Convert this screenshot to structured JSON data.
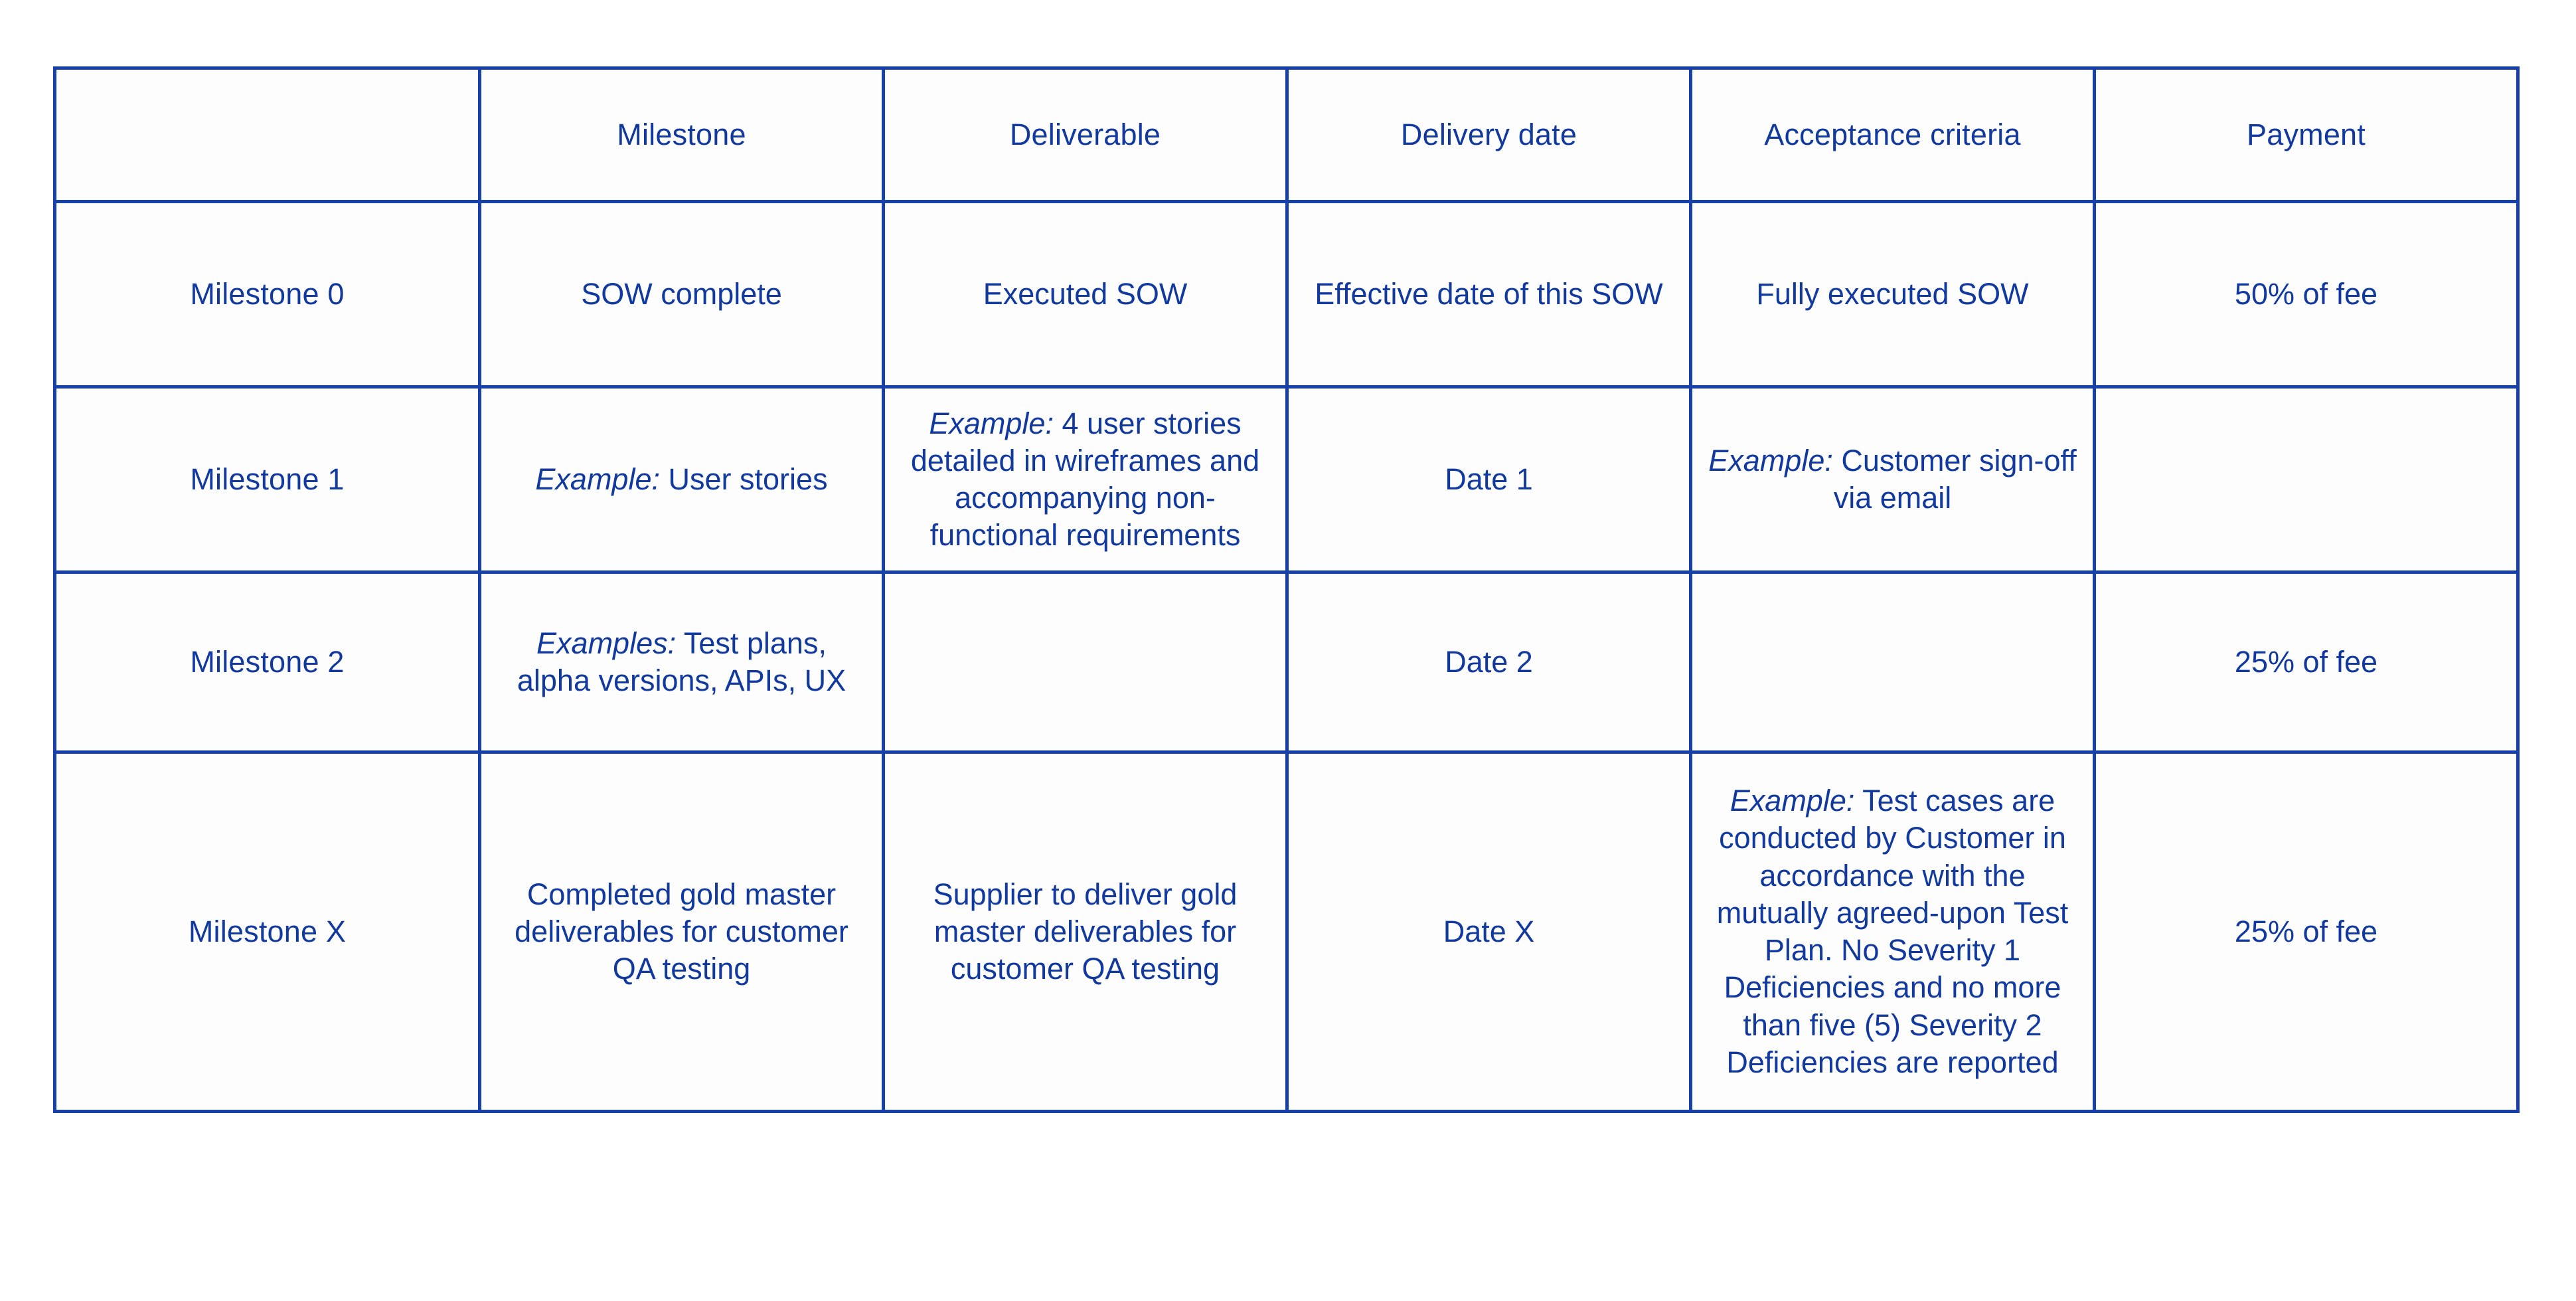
{
  "theme": {
    "border_color": "#1840ab",
    "text_color": "#11399e",
    "background": "#ffffff",
    "cell_background": "#fdfdfd"
  },
  "table": {
    "corner_label": "",
    "headers": [
      "Milestone",
      "Deliverable",
      "Delivery date",
      "Acceptance criteria",
      "Payment"
    ],
    "rows": [
      {
        "label": "Milestone 0",
        "milestone": "SOW complete",
        "milestone_prefix": "",
        "deliverable": "Executed SOW",
        "deliverable_prefix": "",
        "delivery_date": "Effective date of this SOW",
        "acceptance_criteria": "Fully executed SOW",
        "acceptance_prefix": "",
        "payment": "50% of fee"
      },
      {
        "label": "Milestone 1",
        "milestone": "User stories",
        "milestone_prefix": "Example:",
        "deliverable": "4 user stories detailed in wireframes and accompanying non-functional requirements",
        "deliverable_prefix": "Example:",
        "delivery_date": "Date 1",
        "acceptance_criteria": "Customer sign-off via email",
        "acceptance_prefix": "Example:",
        "payment": ""
      },
      {
        "label": "Milestone 2",
        "milestone": "Test plans, alpha versions, APIs, UX",
        "milestone_prefix": "Examples:",
        "deliverable": "",
        "deliverable_prefix": "",
        "delivery_date": "Date 2",
        "acceptance_criteria": "",
        "acceptance_prefix": "",
        "payment": "25% of fee"
      },
      {
        "label": "Milestone X",
        "milestone": "Completed gold master deliverables for customer QA testing",
        "milestone_prefix": "",
        "deliverable": "Supplier to deliver gold master deliverables for customer QA testing",
        "deliverable_prefix": "",
        "delivery_date": "Date X",
        "acceptance_criteria": "Test cases are conducted by Customer in accordance with the mutually agreed-upon Test Plan. No Severity 1 Deficiencies and no more than five (5) Severity 2 Deficiencies are reported",
        "acceptance_prefix": "Example:",
        "payment": "25% of fee"
      }
    ]
  }
}
